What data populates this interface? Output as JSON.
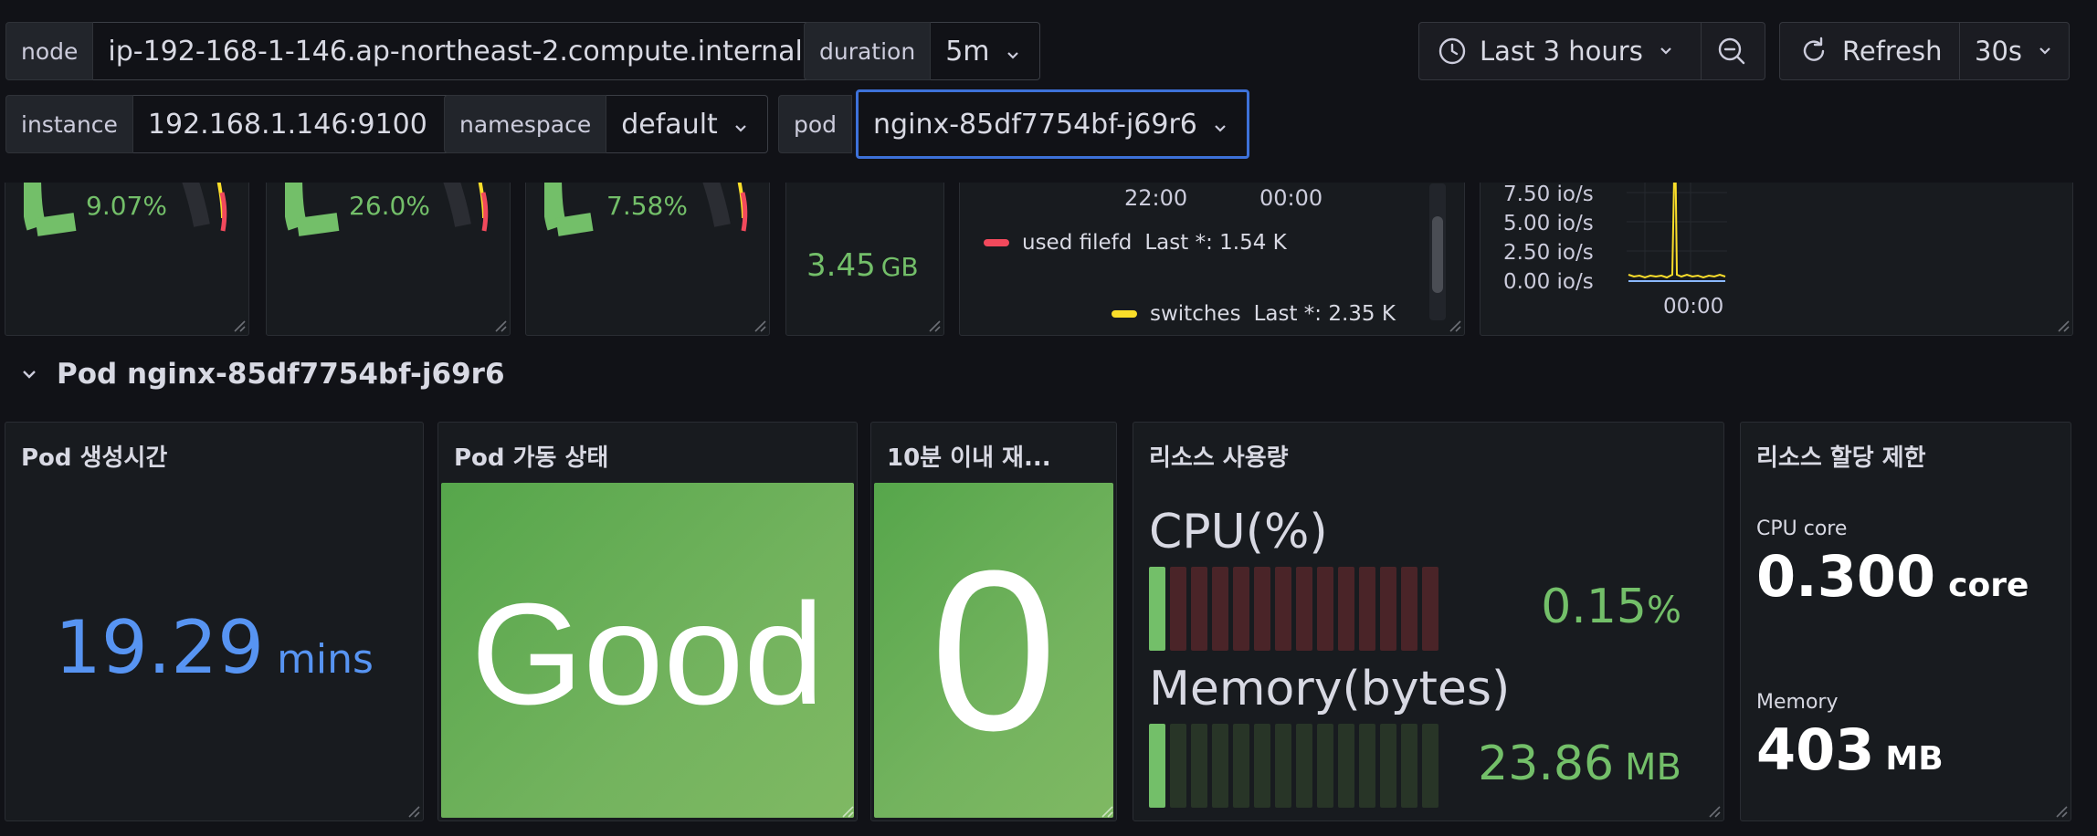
{
  "variables": {
    "node": {
      "label": "node",
      "value": "ip-192-168-1-146.ap-northeast-2.compute.internal"
    },
    "duration": {
      "label": "duration",
      "value": "5m"
    },
    "instance": {
      "label": "instance",
      "value": "192.168.1.146:9100"
    },
    "namespace": {
      "label": "namespace",
      "value": "default"
    },
    "pod": {
      "label": "pod",
      "value": "nginx-85df7754bf-j69r6"
    }
  },
  "controls": {
    "time_range": "Last 3 hours",
    "refresh_label": "Refresh",
    "refresh_interval": "30s"
  },
  "upper_panels": {
    "gauge1_value": "9.07%",
    "gauge2_value": "26.0%",
    "gauge3_value": "7.58%",
    "stat_value": "3.45",
    "stat_unit": "GB",
    "ts_x_labels": [
      "22:00",
      "00:00"
    ],
    "legend": [
      {
        "name": "used filefd",
        "last": "Last *: 1.54 K",
        "color": "#f2495c"
      },
      {
        "name": "switches",
        "last": "Last *: 2.35 K",
        "color": "#fade2a"
      }
    ],
    "io_y_labels": [
      "7.50 io/s",
      "5.00 io/s",
      "2.50 io/s",
      "0.00 io/s"
    ],
    "io_x_label": "00:00"
  },
  "row": {
    "title": "Pod nginx-85df7754bf-j69r6"
  },
  "pod_panels": {
    "created": {
      "title": "Pod 생성시간",
      "value": "19.29",
      "unit": "mins",
      "color": "#5794f2"
    },
    "status": {
      "title": "Pod 가동 상태",
      "value": "Good"
    },
    "restarts": {
      "title": "10분 이내 재...",
      "value": "0"
    },
    "usage": {
      "title": "리소스 사용량",
      "cpu_label": "CPU(%)",
      "cpu_value": "0.15",
      "cpu_unit": "%",
      "cpu_fraction": 0.0015,
      "mem_label": "Memory(bytes)",
      "mem_value": "23.86",
      "mem_unit": "MB"
    },
    "limits": {
      "title": "리소스 할당 제한",
      "cpu_label": "CPU core",
      "cpu_value": "0.300",
      "cpu_unit": "core",
      "mem_label": "Memory",
      "mem_value": "403",
      "mem_unit": "MB"
    }
  },
  "colors": {
    "accent_blue": "#3d71d9",
    "green": "#73bf69",
    "red": "#f2495c",
    "yellow": "#fade2a"
  }
}
